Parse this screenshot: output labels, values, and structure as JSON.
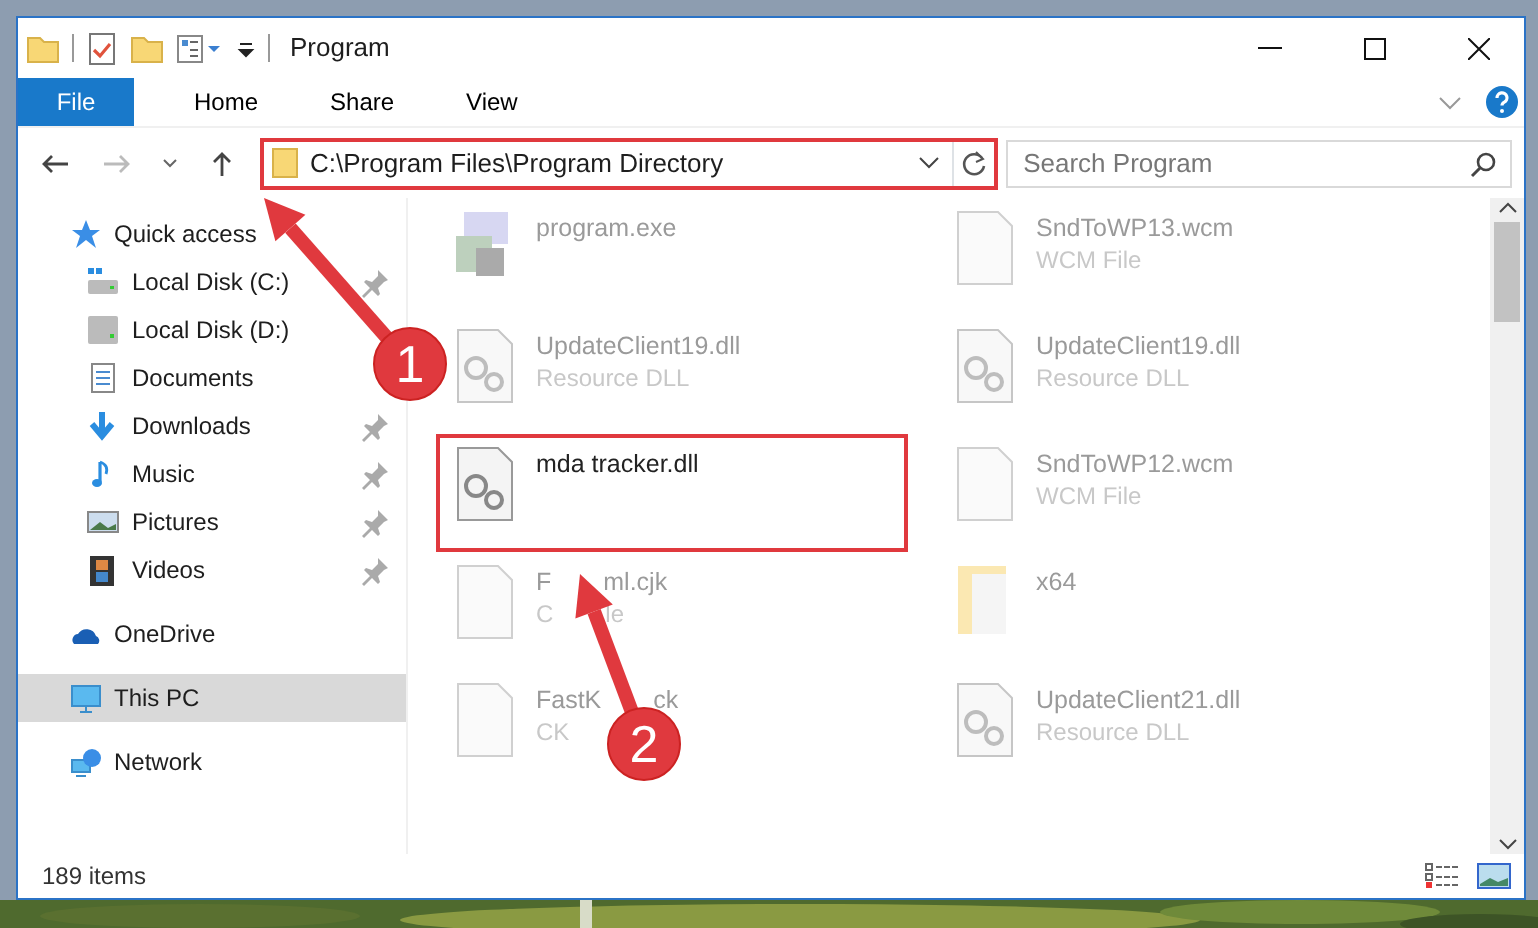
{
  "window": {
    "title": "Program"
  },
  "ribbon_tabs": [
    {
      "label": "File",
      "kind": "file"
    },
    {
      "label": "Home",
      "kind": "tab"
    },
    {
      "label": "Share",
      "kind": "tab"
    },
    {
      "label": "View",
      "kind": "tab"
    }
  ],
  "address": {
    "path": "C:\\Program Files\\Program Directory",
    "highlighted": true
  },
  "search": {
    "placeholder": "Search Program"
  },
  "sidebar": [
    {
      "label": "Quick access",
      "selected": false,
      "children": [
        {
          "label": "Local Disk (C:)",
          "pinned": true
        },
        {
          "label": "Local Disk (D:)"
        },
        {
          "label": "Documents"
        },
        {
          "label": "Downloads",
          "pinned": true
        },
        {
          "label": "Music",
          "pinned": true
        },
        {
          "label": "Pictures",
          "pinned": true
        },
        {
          "label": "Videos",
          "pinned": true
        }
      ]
    },
    {
      "label": "OneDrive",
      "selected": false
    },
    {
      "label": "This PC",
      "selected": true
    },
    {
      "label": "Network",
      "selected": false
    }
  ],
  "files": [
    {
      "name": [
        "program.exe"
      ],
      "faded": true,
      "highlighted": false
    },
    {
      "name": [
        "SndToWP13.wcm"
      ],
      "type": [
        "WCM File"
      ],
      "faded": true,
      "highlighted": false
    },
    {
      "name": [
        "UpdateClient19.dll"
      ],
      "type": [
        "Resource DLL"
      ],
      "faded": true,
      "highlighted": false
    },
    {
      "name": [
        "UpdateClient19.dll"
      ],
      "type": [
        "Resource DLL"
      ],
      "faded": true,
      "highlighted": false
    },
    {
      "name": [
        "mda tracker.dll"
      ],
      "faded": false,
      "highlighted": true
    },
    {
      "name": [
        "SndToWP12.wcm"
      ],
      "type": [
        "WCM File"
      ],
      "faded": true,
      "highlighted": false
    },
    {
      "name": [
        "F",
        "ml.cjk"
      ],
      "type": [
        "C",
        "le"
      ],
      "faded": true,
      "highlighted": false
    },
    {
      "name": [
        "x64"
      ],
      "faded": true,
      "highlighted": false
    },
    {
      "name": [
        "FastK",
        "ck"
      ],
      "type": [
        "CK"
      ],
      "faded": true,
      "highlighted": false
    },
    {
      "name": [
        "UpdateClient21.dll"
      ],
      "type": [
        "Resource DLL"
      ],
      "faded": true,
      "highlighted": false
    }
  ],
  "status_bar": {
    "count": "189 items"
  },
  "annotations": [
    {
      "label": "1"
    },
    {
      "label": "2"
    }
  ]
}
